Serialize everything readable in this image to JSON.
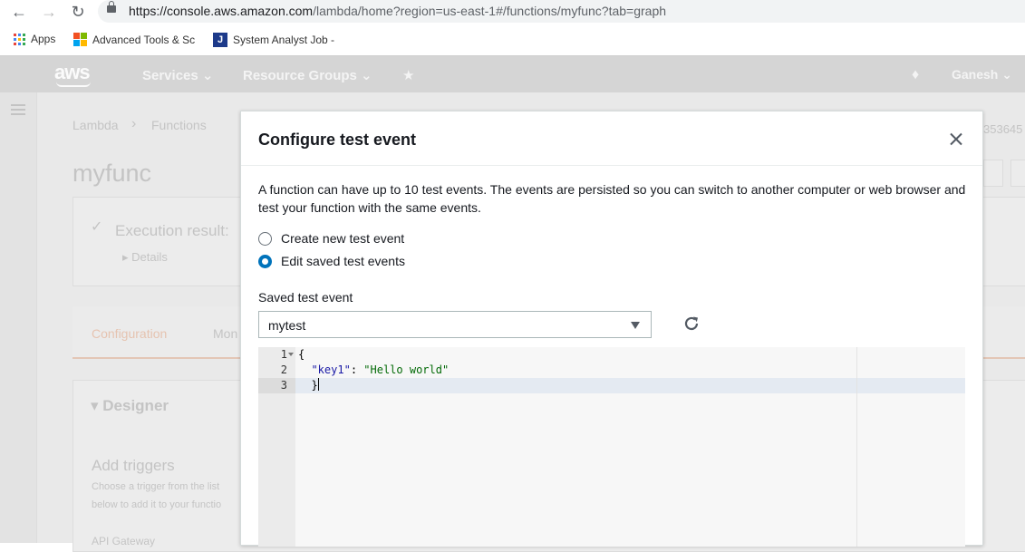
{
  "browser": {
    "url_host": "https://console.aws.amazon.com",
    "url_path": "/lambda/home?region=us-east-1#/functions/myfunc?tab=graph",
    "bookmarks": [
      {
        "label": "Apps"
      },
      {
        "label": "Advanced Tools & Sc"
      },
      {
        "label": "System Analyst Job -"
      }
    ]
  },
  "awsnav": {
    "logo": "aws",
    "services": "Services",
    "resource_groups": "Resource Groups",
    "user": "Ganesh"
  },
  "background": {
    "breadcrumb": [
      "Lambda",
      "Functions"
    ],
    "function_name": "myfunc",
    "execution_result": "Execution result:",
    "details": "Details",
    "tabs": [
      "Configuration",
      "Mon"
    ],
    "designer": "Designer",
    "add_triggers": "Add triggers",
    "add_triggers_desc1": "Choose a trigger from the list",
    "add_triggers_desc2": "below to add it to your functio",
    "api_gateway": "API Gateway",
    "arn_fragment": "353645"
  },
  "modal": {
    "title": "Configure test event",
    "description": "A function can have up to 10 test events. The events are persisted so you can switch to another computer or web browser and test your function with the same events.",
    "radio_create": "Create new test event",
    "radio_edit": "Edit saved test events",
    "saved_label": "Saved test event",
    "saved_value": "mytest",
    "editor": {
      "line_numbers": [
        "1",
        "2",
        "3"
      ],
      "line1": "{",
      "line2_key": "\"key1\"",
      "line2_sep": ": ",
      "line2_val": "\"Hello world\"",
      "line3": "}"
    }
  },
  "colors": {
    "accent": "#0073bb",
    "nav_dimmed": "#d5d5d5",
    "json_string": "#036a07"
  }
}
